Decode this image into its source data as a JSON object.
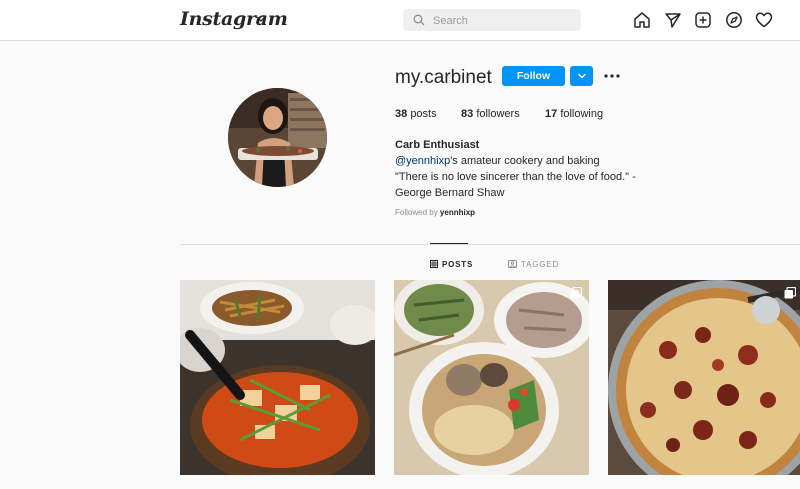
{
  "nav": {
    "logo_text": "Instagram",
    "search_placeholder": "Search",
    "icons": [
      "home-icon",
      "direct-message-icon",
      "new-post-icon",
      "explore-icon",
      "activity-heart-icon"
    ]
  },
  "profile": {
    "username": "my.carbinet",
    "follow_label": "Follow",
    "posts_count": "38",
    "posts_label": "posts",
    "followers_count": "83",
    "followers_label": "followers",
    "following_count": "17",
    "following_label": "following",
    "display_name": "Carb Enthusiast",
    "bio_mention": "@yennhixp",
    "bio_line1_rest": "'s amateur cookery and baking",
    "bio_line2": "\"There is no love sincerer than the love of food.\" -",
    "bio_line3": "George Bernard Shaw",
    "followed_by_prefix": "Followed by",
    "followed_by_user": "yennhixp"
  },
  "tabs": [
    {
      "label": "POSTS",
      "active": true
    },
    {
      "label": "TAGGED",
      "active": false
    }
  ],
  "posts": [
    {
      "name": "kimchi-stew-with-noodles",
      "multi": false
    },
    {
      "name": "noodle-soup-with-sides",
      "multi": true
    },
    {
      "name": "pizza-on-pan",
      "multi": true
    }
  ],
  "colors": {
    "accent": "#0095f6",
    "text": "#262626",
    "muted": "#8e8e8e",
    "background": "#fafafa"
  }
}
